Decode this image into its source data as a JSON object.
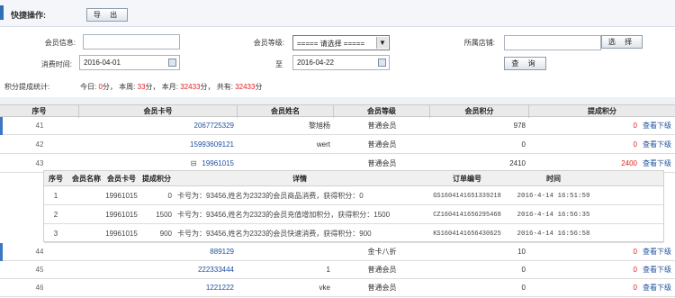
{
  "quick_bar": {
    "title": "快捷操作:",
    "export_label": "导 出"
  },
  "filters": {
    "member_info_label": "会员信息:",
    "member_info_value": "",
    "member_level_label": "会员等级:",
    "member_level_selected": "===== 请选择 =====",
    "store_label": "所属店铺:",
    "store_value": "",
    "select_label": "选 择",
    "time_label": "消费时间:",
    "date_from": "2016-04-01",
    "to_label": "至",
    "date_to": "2016-04-22",
    "query_label": "查 询"
  },
  "stats": {
    "label": "积分提成统计:",
    "today_label": "今日:",
    "today_value": "0",
    "week_label": "本周:",
    "week_value": "33",
    "month_label": "本月:",
    "month_value": "32433",
    "total_label": "共有:",
    "total_value": "32433",
    "unit": "分",
    "sep": "，"
  },
  "table": {
    "headers": [
      "序号",
      "会员卡号",
      "会员姓名",
      "会员等级",
      "会员积分",
      "提成积分"
    ],
    "view_label": "查看下级",
    "rows": [
      {
        "no": "41",
        "card": "2067725329",
        "name": "黎旭杨",
        "level": "普通会员",
        "points": "978",
        "commission": "0"
      },
      {
        "no": "42",
        "card": "15993609121",
        "name": "wert",
        "level": "普通会员",
        "points": "0",
        "commission": "0"
      },
      {
        "no": "43",
        "card": "19961015",
        "name": "",
        "level": "普通会员",
        "points": "2410",
        "commission": "2400",
        "expanded": true,
        "expand_glyph": "⊟"
      },
      {
        "no": "44",
        "card": "889129",
        "name": "",
        "level": "金卡八折",
        "points": "10",
        "commission": "0"
      },
      {
        "no": "45",
        "card": "222333444",
        "name": "1",
        "level": "普通会员",
        "points": "0",
        "commission": "0"
      },
      {
        "no": "46",
        "card": "1221222",
        "name": "vke",
        "level": "普通会员",
        "points": "0",
        "commission": "0"
      }
    ]
  },
  "subtable": {
    "headers": [
      "序号",
      "会员名称",
      "会员卡号",
      "提成积分",
      "详情",
      "订单编号",
      "时间"
    ],
    "rows": [
      {
        "no": "1",
        "name": "",
        "card": "19961015",
        "commission": "0",
        "detail": "卡号为：93456,姓名为2323的会员商品消费，获得积分：0",
        "order": "GS1604141651339218",
        "time": "2016-4-14 16:51:59"
      },
      {
        "no": "2",
        "name": "",
        "card": "19961015",
        "commission": "1500",
        "detail": "卡号为：93456,姓名为2323的会员充值增加积分，获得积分：1500",
        "order": "CZ1604141656295468",
        "time": "2016-4-14 16:56:35"
      },
      {
        "no": "3",
        "name": "",
        "card": "19961015",
        "commission": "900",
        "detail": "卡号为：93456,姓名为2323的会员快速消费，获得积分：900",
        "order": "KS1604141656430625",
        "time": "2016-4-14 16:56:58"
      }
    ]
  }
}
